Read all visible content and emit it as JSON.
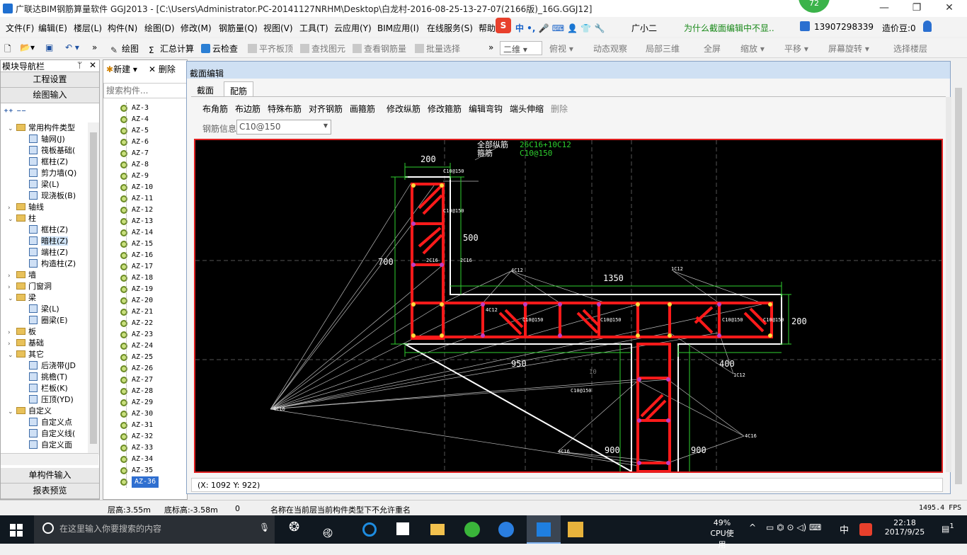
{
  "window": {
    "title": "广联达BIM钢筋算量软件 GGJ2013 - [C:\\Users\\Administrator.PC-20141127NRHM\\Desktop\\白龙村-2016-08-25-13-27-07(2166版)_16G.GGJ12]",
    "badge": "72",
    "minimize": "—",
    "maximize": "❐",
    "close": "✕"
  },
  "menu": [
    "文件(F)",
    "编辑(E)",
    "楼层(L)",
    "构件(N)",
    "绘图(D)",
    "修改(M)",
    "钢筋量(Q)",
    "视图(V)",
    "工具(T)",
    "云应用(Y)",
    "BIM应用(I)",
    "在线服务(S)",
    "帮助"
  ],
  "menu_extra": {
    "assistant": "广小二",
    "question": "为什么截面编辑中不显..",
    "phone": "13907298339",
    "beans": "造价豆:0"
  },
  "toolbar": {
    "draw": "绘图",
    "summary": "汇总计算",
    "cloud_check": "云检查",
    "flush_top": "平齐板顶",
    "find": "查找图元",
    "view_qty": "查看钢筋量",
    "batch_select": "批量选择",
    "view_mode": "二维",
    "plan": "俯视",
    "dynamic": "动态观察",
    "local3d": "局部三维",
    "fullscreen": "全屏",
    "zoom": "缩放",
    "pan": "平移",
    "rotate": "屏幕旋转",
    "select_floor": "选择楼层"
  },
  "nav": {
    "header": "模块导航栏",
    "pin": "ᛘ",
    "close": "✕",
    "btn_settings": "工程设置",
    "btn_draw_input": "绘图输入",
    "btn_single": "单构件输入",
    "btn_report": "报表预览",
    "tree": [
      {
        "label": "常用构件类型",
        "level": 1,
        "type": "folder",
        "expanded": true
      },
      {
        "label": "轴网(J)",
        "level": 2,
        "type": "item"
      },
      {
        "label": "筏板基础(",
        "level": 2,
        "type": "item"
      },
      {
        "label": "框柱(Z)",
        "level": 2,
        "type": "item"
      },
      {
        "label": "剪力墙(Q)",
        "level": 2,
        "type": "item"
      },
      {
        "label": "梁(L)",
        "level": 2,
        "type": "item"
      },
      {
        "label": "现浇板(B)",
        "level": 2,
        "type": "item"
      },
      {
        "label": "轴线",
        "level": 1,
        "type": "folder",
        "expanded": false
      },
      {
        "label": "柱",
        "level": 1,
        "type": "folder",
        "expanded": true
      },
      {
        "label": "框柱(Z)",
        "level": 2,
        "type": "item"
      },
      {
        "label": "暗柱(Z)",
        "level": 2,
        "type": "item",
        "selected": true
      },
      {
        "label": "端柱(Z)",
        "level": 2,
        "type": "item"
      },
      {
        "label": "构造柱(Z)",
        "level": 2,
        "type": "item"
      },
      {
        "label": "墙",
        "level": 1,
        "type": "folder",
        "expanded": false
      },
      {
        "label": "门窗洞",
        "level": 1,
        "type": "folder",
        "expanded": false
      },
      {
        "label": "梁",
        "level": 1,
        "type": "folder",
        "expanded": true
      },
      {
        "label": "梁(L)",
        "level": 2,
        "type": "item"
      },
      {
        "label": "圈梁(E)",
        "level": 2,
        "type": "item"
      },
      {
        "label": "板",
        "level": 1,
        "type": "folder",
        "expanded": false
      },
      {
        "label": "基础",
        "level": 1,
        "type": "folder",
        "expanded": false
      },
      {
        "label": "其它",
        "level": 1,
        "type": "folder",
        "expanded": true
      },
      {
        "label": "后浇带(JD",
        "level": 2,
        "type": "item"
      },
      {
        "label": "挑檐(T)",
        "level": 2,
        "type": "item"
      },
      {
        "label": "栏板(K)",
        "level": 2,
        "type": "item"
      },
      {
        "label": "压顶(YD)",
        "level": 2,
        "type": "item"
      },
      {
        "label": "自定义",
        "level": 1,
        "type": "folder",
        "expanded": true
      },
      {
        "label": "自定义点",
        "level": 2,
        "type": "item"
      },
      {
        "label": "自定义线(",
        "level": 2,
        "type": "item"
      },
      {
        "label": "自定义面",
        "level": 2,
        "type": "item"
      }
    ]
  },
  "list": {
    "new": "新建",
    "delete": "删除",
    "search_placeholder": "搜索构件...",
    "items": [
      "AZ-3",
      "AZ-4",
      "AZ-5",
      "AZ-6",
      "AZ-7",
      "AZ-8",
      "AZ-9",
      "AZ-10",
      "AZ-11",
      "AZ-12",
      "AZ-13",
      "AZ-14",
      "AZ-15",
      "AZ-16",
      "AZ-17",
      "AZ-18",
      "AZ-19",
      "AZ-20",
      "AZ-21",
      "AZ-22",
      "AZ-23",
      "AZ-24",
      "AZ-25",
      "AZ-26",
      "AZ-27",
      "AZ-28",
      "AZ-29",
      "AZ-30",
      "AZ-31",
      "AZ-32",
      "AZ-33",
      "AZ-34",
      "AZ-35",
      "AZ-36"
    ],
    "selected": "AZ-36"
  },
  "dialog": {
    "title": "截面编辑",
    "tabs": [
      "截面",
      "配筋"
    ],
    "active_tab": "配筋",
    "rebar_buttons": [
      "布角筋",
      "布边筋",
      "特殊布筋",
      "对齐钢筋",
      "画箍筋",
      "修改纵筋",
      "修改箍筋",
      "编辑弯钩",
      "端头伸缩",
      "删除"
    ],
    "rebar_info_label": "钢筋信息",
    "rebar_info_value": "C10@150",
    "coords": "(X: 1092 Y: 922)"
  },
  "drawing": {
    "total_label": "全部纵筋",
    "total_value": "26C16+10C12",
    "stirrup_label": "箍筋",
    "stirrup_value": "C10@150",
    "dims": {
      "d200a": "200",
      "d500": "500",
      "d700": "700",
      "d1350": "1350",
      "d200b": "200",
      "d950": "950",
      "d400": "400",
      "d900a": "900",
      "d900b": "900"
    },
    "small": {
      "c1": "C10@150",
      "c2": "C10@150",
      "c3": "2C16",
      "c4": "2C16",
      "c5": "4C12",
      "c6": "1C12",
      "c7": "4C12",
      "c8": "C10@150",
      "c9": "C10@150",
      "c10": "C10@150",
      "c11": "C10@150",
      "c12": "1C12",
      "c13": "C10@150",
      "c14": "4C16",
      "c15": "4C16",
      "c16": "4C16",
      "c17": "10"
    }
  },
  "status": {
    "floor_height": "层高:3.55m",
    "bottom_elev": "底标高:-3.58m",
    "zero": "0",
    "message": "名称在当前层当前构件类型下不允许重名",
    "fps": "1495.4 FPS"
  },
  "taskbar": {
    "search": "在这里输入你要搜索的内容",
    "cpu_pct": "49%",
    "cpu_label": "CPU使用",
    "ime": "中",
    "time": "22:18",
    "date": "2017/9/25",
    "notify": "1"
  }
}
